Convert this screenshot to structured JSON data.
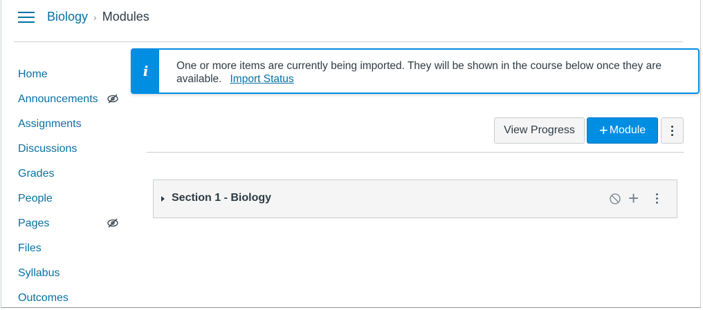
{
  "header": {
    "course": "Biology",
    "separator": "›",
    "current": "Modules"
  },
  "nav": {
    "items": [
      {
        "label": "Home",
        "hidden_icon": false
      },
      {
        "label": "Announcements",
        "hidden_icon": true
      },
      {
        "label": "Assignments",
        "hidden_icon": false
      },
      {
        "label": "Discussions",
        "hidden_icon": false
      },
      {
        "label": "Grades",
        "hidden_icon": false
      },
      {
        "label": "People",
        "hidden_icon": false
      },
      {
        "label": "Pages",
        "hidden_icon": true
      },
      {
        "label": "Files",
        "hidden_icon": false
      },
      {
        "label": "Syllabus",
        "hidden_icon": false
      },
      {
        "label": "Outcomes",
        "hidden_icon": false
      }
    ]
  },
  "alert": {
    "icon": "i",
    "message": "One or more items are currently being imported. They will be shown in the course below once they are available.",
    "link": "Import Status"
  },
  "toolbar": {
    "view_progress": "View Progress",
    "add_module_plus": "+",
    "add_module": "Module"
  },
  "module": {
    "title": "Section 1 - Biology",
    "add": "+"
  },
  "colors": {
    "link": "#0770a3",
    "primary": "#008ee2",
    "text": "#2d3b45",
    "border": "#c7cdd1"
  }
}
